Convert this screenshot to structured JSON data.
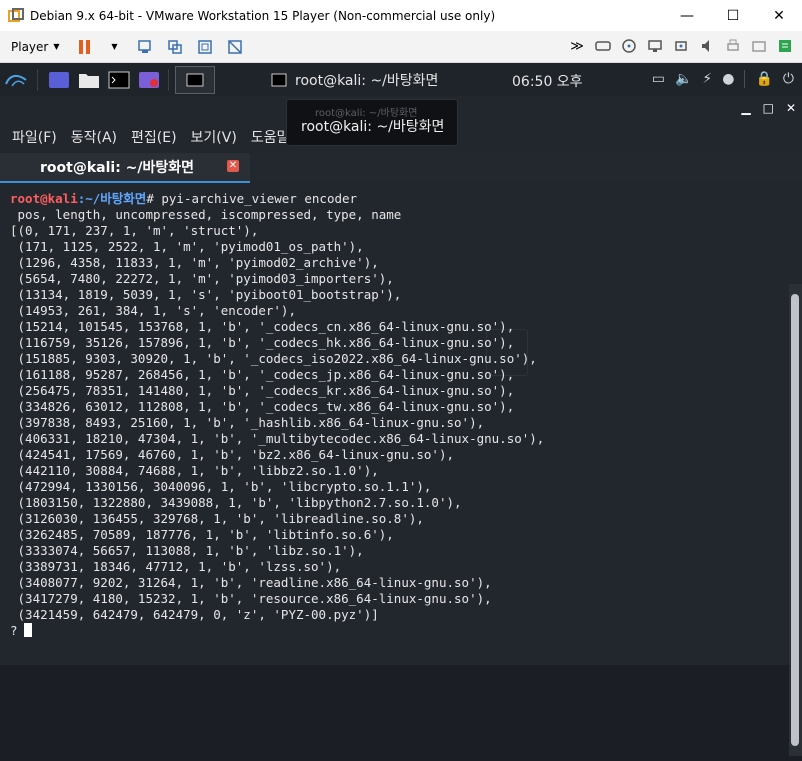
{
  "window": {
    "title": "Debian 9.x 64-bit - VMware Workstation 15 Player (Non-commercial use only)",
    "minimize": "—",
    "maximize": "☐",
    "close": "✕"
  },
  "vmware_toolbar": {
    "player_label": "Player",
    "icons": [
      "pause-icon",
      "dropdown-icon",
      "send-ctrl-alt-del-icon",
      "library-icon",
      "fullscreen-icon",
      "unity-icon"
    ],
    "right_icons": [
      "forward-icon",
      "drive-icon",
      "cd-icon",
      "network-icon",
      "usb-icon",
      "sound-icon",
      "printer-icon",
      "tray-icon",
      "notes-icon"
    ]
  },
  "kali_panel": {
    "task_title": "root@kali: ~/바탕화면",
    "clock": "06:50 오후"
  },
  "terminal": {
    "tooltip": "root@kali: ~/바탕화면",
    "tooltip_ghost": "root@kali: ~/바탕화면",
    "menu": [
      "파일(F)",
      "동작(A)",
      "편집(E)",
      "보기(V)",
      "도움말(H)"
    ],
    "tab_label": "root@kali: ~/바탕화면",
    "tab_close": "✕",
    "prompt_user": "root@kali",
    "prompt_path": ":~/바탕화면",
    "prompt_symbol": "# ",
    "command": "pyi-archive_viewer encoder",
    "output": [
      " pos, length, uncompressed, iscompressed, type, name",
      "[(0, 171, 237, 1, 'm', 'struct'),",
      " (171, 1125, 2522, 1, 'm', 'pyimod01_os_path'),",
      " (1296, 4358, 11833, 1, 'm', 'pyimod02_archive'),",
      " (5654, 7480, 22272, 1, 'm', 'pyimod03_importers'),",
      " (13134, 1819, 5039, 1, 's', 'pyiboot01_bootstrap'),",
      " (14953, 261, 384, 1, 's', 'encoder'),",
      " (15214, 101545, 153768, 1, 'b', '_codecs_cn.x86_64-linux-gnu.so'),",
      " (116759, 35126, 157896, 1, 'b', '_codecs_hk.x86_64-linux-gnu.so'),",
      " (151885, 9303, 30920, 1, 'b', '_codecs_iso2022.x86_64-linux-gnu.so'),",
      " (161188, 95287, 268456, 1, 'b', '_codecs_jp.x86_64-linux-gnu.so'),",
      " (256475, 78351, 141480, 1, 'b', '_codecs_kr.x86_64-linux-gnu.so'),",
      " (334826, 63012, 112808, 1, 'b', '_codecs_tw.x86_64-linux-gnu.so'),",
      " (397838, 8493, 25160, 1, 'b', '_hashlib.x86_64-linux-gnu.so'),",
      " (406331, 18210, 47304, 1, 'b', '_multibytecodec.x86_64-linux-gnu.so'),",
      " (424541, 17569, 46760, 1, 'b', 'bz2.x86_64-linux-gnu.so'),",
      " (442110, 30884, 74688, 1, 'b', 'libbz2.so.1.0'),",
      " (472994, 1330156, 3040096, 1, 'b', 'libcrypto.so.1.1'),",
      " (1803150, 1322880, 3439088, 1, 'b', 'libpython2.7.so.1.0'),",
      " (3126030, 136455, 329768, 1, 'b', 'libreadline.so.8'),",
      " (3262485, 70589, 187776, 1, 'b', 'libtinfo.so.6'),",
      " (3333074, 56657, 113088, 1, 'b', 'libz.so.1'),",
      " (3389731, 18346, 47712, 1, 'b', 'lzss.so'),",
      " (3408077, 9202, 31264, 1, 'b', 'readline.x86_64-linux-gnu.so'),",
      " (3417279, 4180, 15232, 1, 'b', 'resource.x86_64-linux-gnu.so'),",
      " (3421459, 642479, 642479, 0, 'z', 'PYZ-00.pyz')]"
    ],
    "input_prompt": "?"
  }
}
